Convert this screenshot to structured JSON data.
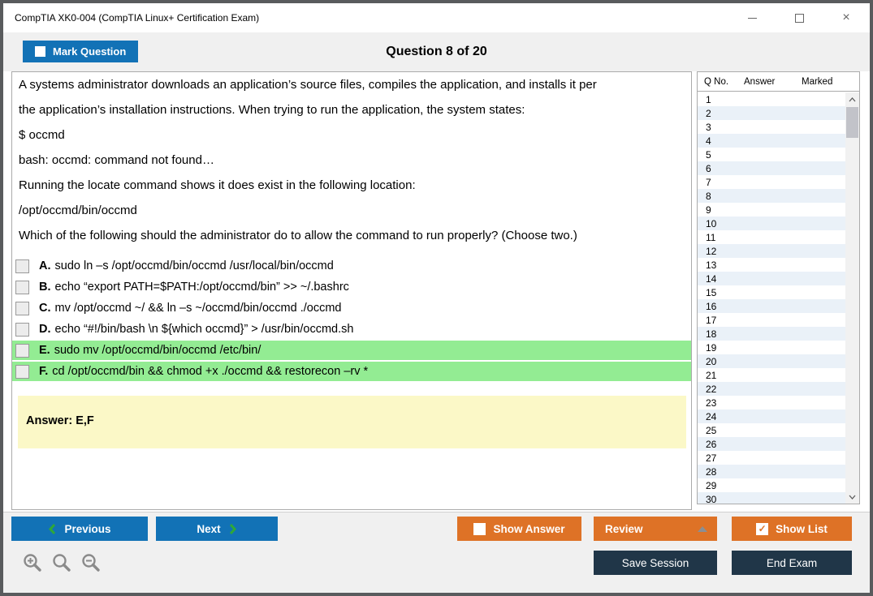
{
  "window": {
    "title": "CompTIA XK0-004 (CompTIA Linux+ Certification Exam)"
  },
  "header": {
    "mark_question": "Mark Question",
    "question_counter": "Question 8 of 20"
  },
  "question": {
    "lines": [
      "A systems administrator downloads an application’s source files, compiles the application, and installs it per",
      "the application’s installation instructions. When trying to run the application, the system states:",
      "$ occmd",
      "bash: occmd: command not found…",
      "Running the locate command shows it does exist in the following location:",
      "/opt/occmd/bin/occmd",
      "Which of the following should the administrator do to allow the command to run properly? (Choose two.)"
    ],
    "options": [
      {
        "letter": "A.",
        "text": "sudo ln –s /opt/occmd/bin/occmd /usr/local/bin/occmd",
        "highlighted": false
      },
      {
        "letter": "B.",
        "text": "echo “export PATH=$PATH:/opt/occmd/bin” >> ~/.bashrc",
        "highlighted": false
      },
      {
        "letter": "C.",
        "text": "mv /opt/occmd ~/ && ln –s ~/occmd/bin/occmd ./occmd",
        "highlighted": false
      },
      {
        "letter": "D.",
        "text": "echo “#!/bin/bash \\n ${which occmd}” > /usr/bin/occmd.sh",
        "highlighted": false
      },
      {
        "letter": "E.",
        "text": "sudo mv /opt/occmd/bin/occmd /etc/bin/",
        "highlighted": true
      },
      {
        "letter": "F.",
        "text": "cd /opt/occmd/bin && chmod +x ./occmd && restorecon –rv *",
        "highlighted": true
      }
    ],
    "answer": "Answer: E,F"
  },
  "sidebar": {
    "columns": {
      "qno": "Q No.",
      "answer": "Answer",
      "marked": "Marked"
    },
    "rows": [
      "1",
      "2",
      "3",
      "4",
      "5",
      "6",
      "7",
      "8",
      "9",
      "10",
      "11",
      "12",
      "13",
      "14",
      "15",
      "16",
      "17",
      "18",
      "19",
      "20",
      "21",
      "22",
      "23",
      "24",
      "25",
      "26",
      "27",
      "28",
      "29",
      "30"
    ]
  },
  "footer": {
    "previous": "Previous",
    "next": "Next",
    "show_answer": "Show Answer",
    "review": "Review",
    "show_list": "Show List",
    "show_list_check": "✓",
    "save_session": "Save Session",
    "end_exam": "End Exam"
  },
  "colors": {
    "accent_blue": "#1272B6",
    "accent_orange": "#DE7226",
    "accent_navy": "#203648",
    "correct_green": "#93EC93",
    "answer_yellow": "#FBF8C7",
    "row_alt_blue": "#EAF1F8",
    "chevron_green": "#2FA838"
  }
}
